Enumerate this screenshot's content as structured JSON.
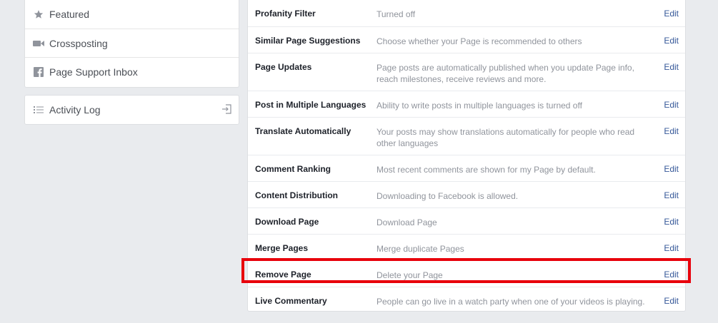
{
  "sidebar": {
    "items": [
      {
        "label": "Featured",
        "icon": "star-icon"
      },
      {
        "label": "Crossposting",
        "icon": "video-camera-icon"
      },
      {
        "label": "Page Support Inbox",
        "icon": "facebook-icon"
      }
    ],
    "activity_log": {
      "label": "Activity Log",
      "icon": "list-icon",
      "right_icon": "sign-in-icon"
    }
  },
  "settings": {
    "edit_label": "Edit",
    "rows": [
      {
        "label": "Profanity Filter",
        "desc": "Turned off"
      },
      {
        "label": "Similar Page Suggestions",
        "desc": "Choose whether your Page is recommended to others"
      },
      {
        "label": "Page Updates",
        "desc": "Page posts are automatically published when you update Page info, reach milestones, receive reviews and more."
      },
      {
        "label": "Post in Multiple Languages",
        "desc": "Ability to write posts in multiple languages is turned off"
      },
      {
        "label": "Translate Automatically",
        "desc": "Your posts may show translations automatically for people who read other languages"
      },
      {
        "label": "Comment Ranking",
        "desc": "Most recent comments are shown for my Page by default."
      },
      {
        "label": "Content Distribution",
        "desc": "Downloading to Facebook is allowed."
      },
      {
        "label": "Download Page",
        "desc": "Download Page"
      },
      {
        "label": "Merge Pages",
        "desc": "Merge duplicate Pages"
      },
      {
        "label": "Remove Page",
        "desc": "Delete your Page"
      },
      {
        "label": "Live Commentary",
        "desc": "People can go live in a watch party when one of your videos is playing."
      }
    ]
  },
  "colors": {
    "link": "#365899",
    "highlight": "#e8000b"
  }
}
